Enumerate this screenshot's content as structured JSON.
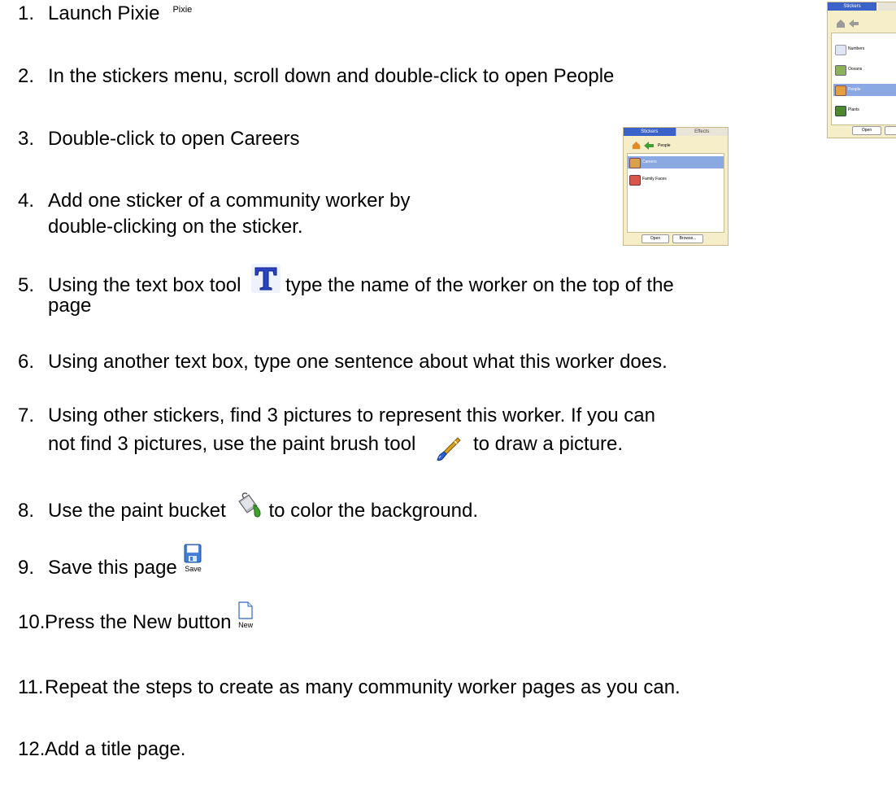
{
  "steps": [
    {
      "num": "1.",
      "text": "Launch Pixie"
    },
    {
      "num": "2.",
      "text": "In the stickers menu, scroll down and double-click to open People"
    },
    {
      "num": "3.",
      "text": "Double-click to open Careers"
    },
    {
      "num": "4.",
      "line1": "Add one sticker of a community worker by",
      "line2": "double-clicking on the sticker."
    },
    {
      "num": "5.",
      "before": "Using the text box tool",
      "after": "type the name of the worker on the top of the",
      "line2": "page"
    },
    {
      "num": "6.",
      "text": "Using another text box, type one sentence about what this worker does."
    },
    {
      "num": "7.",
      "line1": "Using other stickers, find 3 pictures to represent this worker.  If you can",
      "line2_before": "not find 3 pictures, use the paint brush tool",
      "line2_after": "to draw a picture."
    },
    {
      "num": "8.",
      "before": "Use the paint bucket",
      "after": "to color the background."
    },
    {
      "num": "9.",
      "text": "Save this page"
    },
    {
      "num": "10.",
      "text": "Press the New button"
    },
    {
      "num": "11.",
      "text": "Repeat the steps to create as many community worker pages as you can."
    },
    {
      "num": "12.",
      "text": "Add a title page."
    }
  ],
  "pixie_label": "Pixie",
  "save_label": "Save",
  "new_label": "New",
  "panel_top": {
    "tab_stickers": "Stickers",
    "items": [
      "Numbers",
      "Oceans",
      "People",
      "Plants"
    ],
    "open_label": "Open"
  },
  "panel_mid": {
    "tab_stickers": "Stickers",
    "tab_effects": "Effects",
    "crumb": "People",
    "items": [
      "Careers",
      "Family Faces"
    ],
    "open_label": "Open",
    "browse_label": "Browse..."
  }
}
